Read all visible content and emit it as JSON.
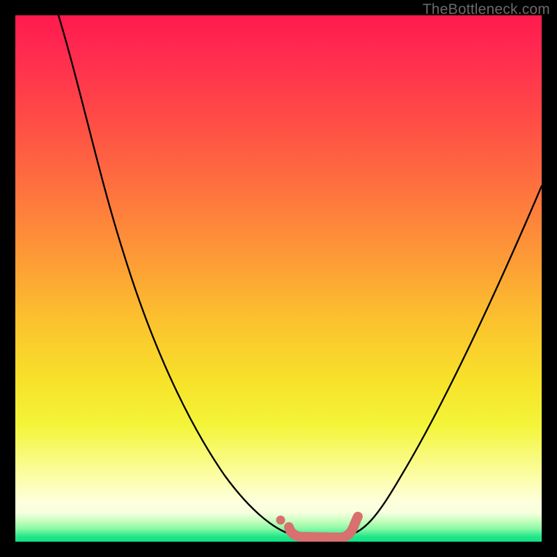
{
  "watermark": {
    "text": "TheBottleneck.com"
  },
  "chart_data": {
    "type": "line",
    "title": "",
    "xlabel": "",
    "ylabel": "",
    "xlim": [
      0,
      100
    ],
    "ylim": [
      0,
      100
    ],
    "grid": false,
    "series": [
      {
        "name": "bottleneck-curve",
        "x": [
          10,
          14,
          18,
          22,
          26,
          30,
          34,
          38,
          42,
          46,
          50,
          54,
          58,
          62,
          66,
          70,
          74,
          78,
          82,
          86,
          90,
          94,
          98
        ],
        "values": [
          100,
          91,
          82,
          73,
          64,
          55,
          46,
          37,
          28,
          19,
          10,
          4,
          1,
          1,
          2,
          8,
          16,
          26,
          36,
          46,
          56,
          66,
          76
        ]
      }
    ],
    "annotations": [
      {
        "name": "trough-band",
        "x_start": 51,
        "x_end": 64,
        "style": "coral-strip"
      }
    ],
    "background_gradient": {
      "top": "#ff1a4d",
      "mid": "#fbc22e",
      "bottom": "#0fe183"
    }
  }
}
